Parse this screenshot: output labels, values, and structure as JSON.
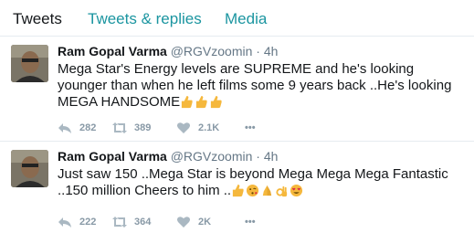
{
  "tabs": [
    {
      "label": "Tweets"
    },
    {
      "label": "Tweets & replies"
    },
    {
      "label": "Media"
    }
  ],
  "tweets": [
    {
      "name": "Ram Gopal Varma",
      "handle": "@RGVzoomin",
      "separator": "·",
      "time": "4h",
      "text": "Mega Star's Energy levels are SUPREME and he's looking younger than when he left films some 9 years back ..He's looking MEGA HANDSOME",
      "emojis": [
        "thumbs-up",
        "thumbs-up",
        "thumbs-up"
      ],
      "replies": "282",
      "retweets": "389",
      "likes": "2.1K",
      "more": "•••"
    },
    {
      "name": "Ram Gopal Varma",
      "handle": "@RGVzoomin",
      "separator": "·",
      "time": "4h",
      "text": "Just saw 150 ..Mega Star is beyond Mega Mega Mega Fantastic ..150 million Cheers to him ..",
      "emojis": [
        "thumbs-up",
        "kiss-face",
        "folded-hands",
        "ok-hand",
        "heart-eyes-face"
      ],
      "replies": "222",
      "retweets": "364",
      "likes": "2K",
      "more": "•••"
    }
  ],
  "colors": {
    "accent": "#1b95a0",
    "text": "#14171a",
    "muted": "#657786",
    "action": "#8899a6",
    "divider": "#e6ecf0"
  }
}
